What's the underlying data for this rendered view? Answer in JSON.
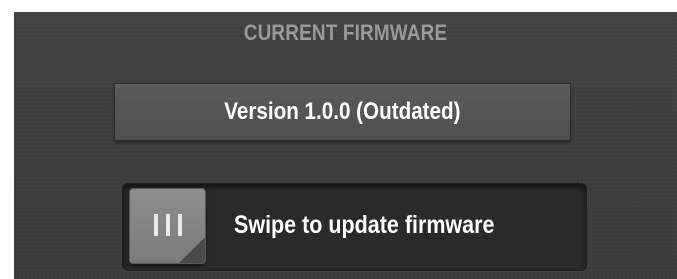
{
  "firmware": {
    "section_title": "CURRENT FIRMWARE",
    "version_text": "Version 1.0.0 (Outdated)"
  },
  "update_slider": {
    "label": "Swipe to update firmware",
    "knob_icon": "grip-lines-icon",
    "progress": 0
  }
}
